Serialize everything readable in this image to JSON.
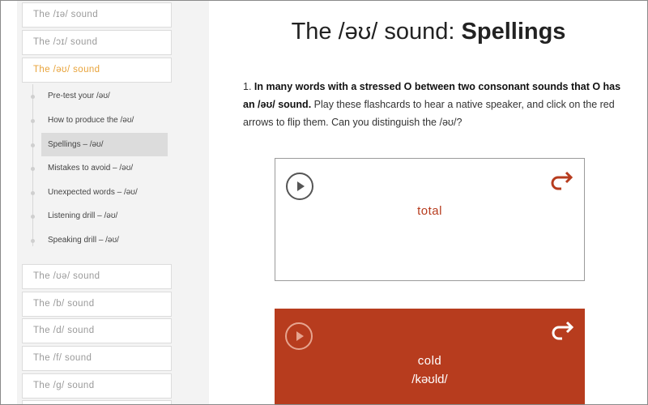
{
  "sidebar": {
    "top_sounds": [
      {
        "label": "The /ɪə/ sound"
      },
      {
        "label": "The /ɔɪ/ sound"
      },
      {
        "label": "The /əʊ/ sound"
      }
    ],
    "subitems": [
      {
        "label": "Pre-test your /əʊ/"
      },
      {
        "label": "How to produce the /əʊ/"
      },
      {
        "label": "Spellings – /əʊ/"
      },
      {
        "label": "Mistakes to avoid – /əʊ/"
      },
      {
        "label": "Unexpected words – /əʊ/"
      },
      {
        "label": "Listening drill – /əʊ/"
      },
      {
        "label": "Speaking drill – /əʊ/"
      }
    ],
    "bottom_sounds": [
      {
        "label": "The /ʊə/ sound"
      },
      {
        "label": "The /b/ sound"
      },
      {
        "label": "The /d/ sound"
      },
      {
        "label": "The /f/ sound"
      },
      {
        "label": "The /g/ sound"
      }
    ],
    "active_color": "#e8a33a"
  },
  "main": {
    "title_prefix": "The /əʊ/ sound: ",
    "title_bold": "Spellings",
    "para_number": "1. ",
    "para_bold": "In many words with a stressed O between two consonant sounds that O has an /əʊ/ sound.",
    "para_text": " Play these flashcards to hear a native speaker, and click on the red arrows to flip them. Can you distinguish the /əʊ/?",
    "cards": [
      {
        "word": "total",
        "icons": [
          "play-icon",
          "flip-arrow-icon"
        ]
      },
      {
        "word": "cold",
        "ipa": "/kəʊld/",
        "icons": [
          "play-icon",
          "flip-arrow-icon"
        ]
      }
    ],
    "accent_color": "#b73c1e"
  }
}
